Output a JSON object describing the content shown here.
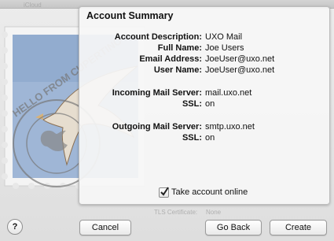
{
  "ghost": {
    "toolbar_tab": "iCloud",
    "cert_label": "TLS Certificate:",
    "cert_value": "None"
  },
  "stamp": {
    "postmark_text": "HELLO FROM CUPERTINO"
  },
  "summary": {
    "title": "Account Summary",
    "rows": [
      {
        "label": "Account Description:",
        "value": "UXO Mail"
      },
      {
        "label": "Full Name:",
        "value": "Joe Users"
      },
      {
        "label": "Email Address:",
        "value": "JoeUser@uxo.net"
      },
      {
        "label": "User Name:",
        "value": "JoeUser@uxo.net"
      },
      {
        "label": "Incoming Mail Server:",
        "value": "mail.uxo.net"
      },
      {
        "label": "SSL:",
        "value": "on"
      },
      {
        "label": "Outgoing Mail Server:",
        "value": "smtp.uxo.net"
      },
      {
        "label": "SSL:",
        "value": "on"
      }
    ],
    "take_online": {
      "label": "Take account online",
      "checked": true
    }
  },
  "buttons": {
    "help": "?",
    "cancel": "Cancel",
    "go_back": "Go Back",
    "create": "Create"
  }
}
